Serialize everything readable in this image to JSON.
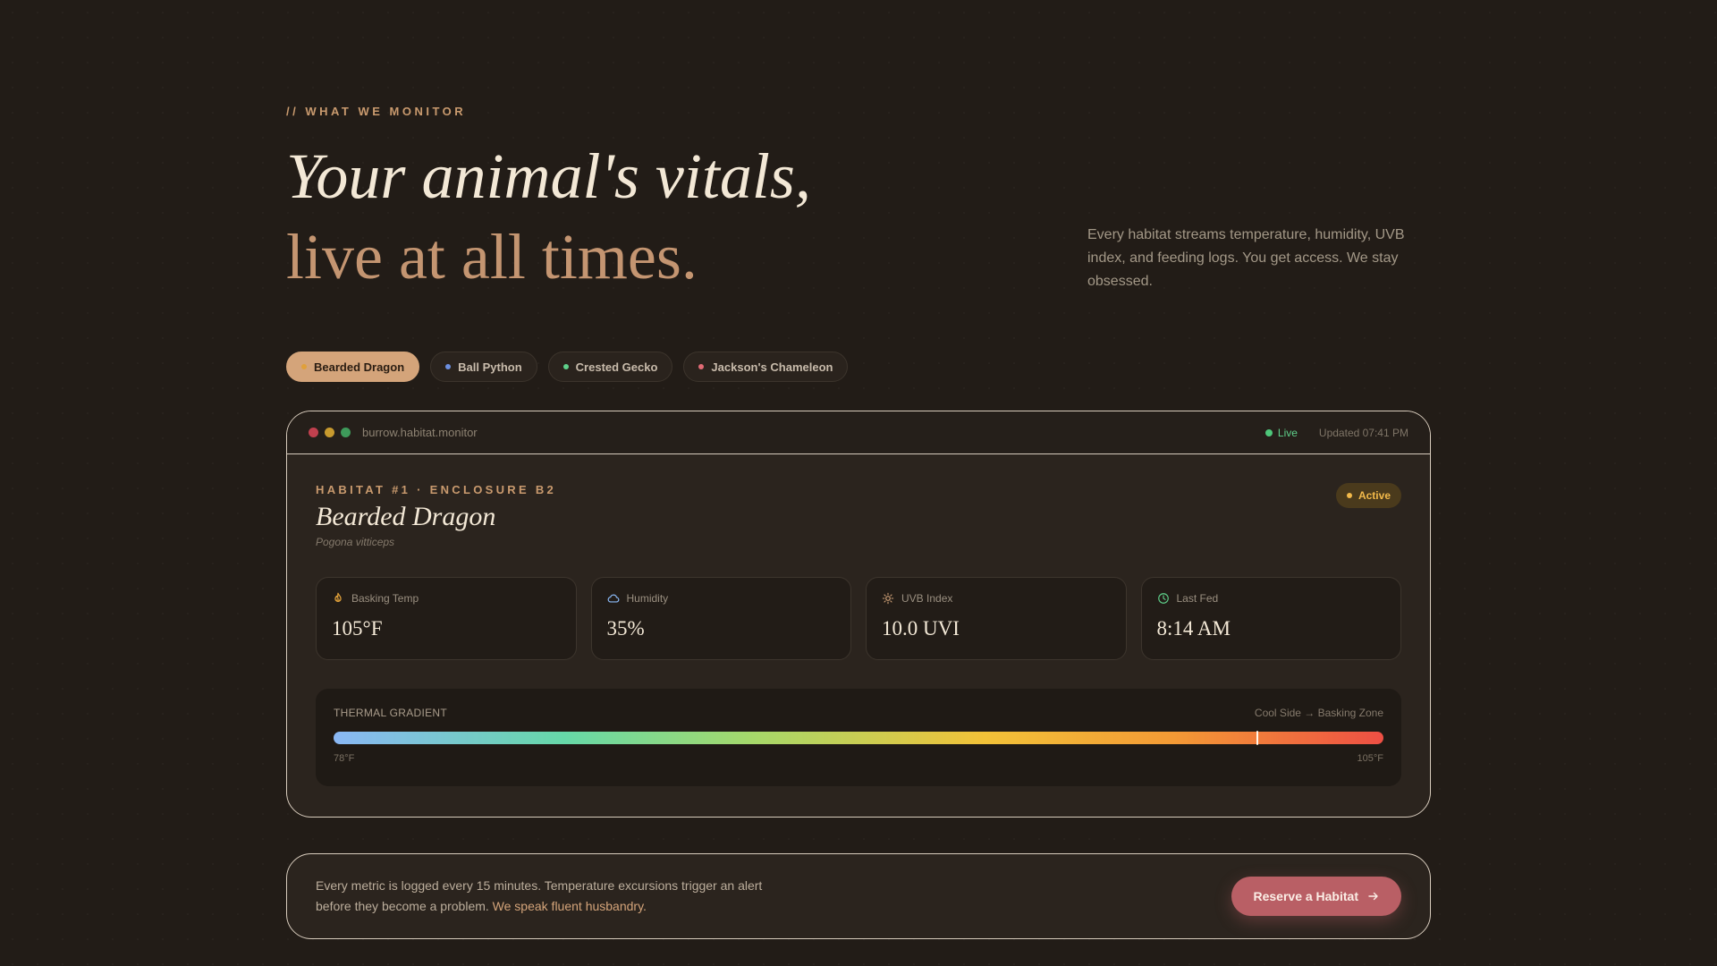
{
  "eyebrow": "// WHAT WE MONITOR",
  "headline": {
    "line1": "Your animal's vitals,",
    "line2": "live at all times."
  },
  "intro": "Every habitat streams temperature, humidity, UVB index, and feeding logs. You get access. We stay obsessed.",
  "tabs": [
    {
      "label": "Bearded Dragon",
      "dot_color": "#e0a03a",
      "active": true
    },
    {
      "label": "Ball Python",
      "dot_color": "#6c8fe0",
      "active": false
    },
    {
      "label": "Crested Gecko",
      "dot_color": "#5ed08a",
      "active": false
    },
    {
      "label": "Jackson's Chameleon",
      "dot_color": "#e06a74",
      "active": false
    }
  ],
  "window": {
    "url": "burrow.habitat.monitor",
    "live_label": "Live",
    "updated": "Updated 07:41 PM",
    "dot_colors": [
      "#c0404e",
      "#c89a2e",
      "#3e9a5a"
    ]
  },
  "habitat": {
    "id_label": "HABITAT #1 · ENCLOSURE B2",
    "name": "Bearded Dragon",
    "scientific": "Pogona vitticeps",
    "status": "Active"
  },
  "metrics": [
    {
      "label": "Basking Temp",
      "value": "105°F",
      "icon": "flame-icon",
      "color": "#e0a03a"
    },
    {
      "label": "Humidity",
      "value": "35%",
      "icon": "cloud-icon",
      "color": "#8ab8f5"
    },
    {
      "label": "UVB Index",
      "value": "10.0 UVI",
      "icon": "sun-icon",
      "color": "#d4a47a"
    },
    {
      "label": "Last Fed",
      "value": "8:14 AM",
      "icon": "clock-icon",
      "color": "#5ed08a"
    }
  ],
  "thermal": {
    "title": "THERMAL GRADIENT",
    "legend": "Cool Side → Basking Zone",
    "min_label": "78°F",
    "max_label": "105°F",
    "marker_fraction": 0.88
  },
  "footer": {
    "text": "Every metric is logged every 15 minutes. Temperature excursions trigger an alert before they become a problem.",
    "link": "We speak fluent husbandry.",
    "cta": "Reserve a Habitat"
  }
}
